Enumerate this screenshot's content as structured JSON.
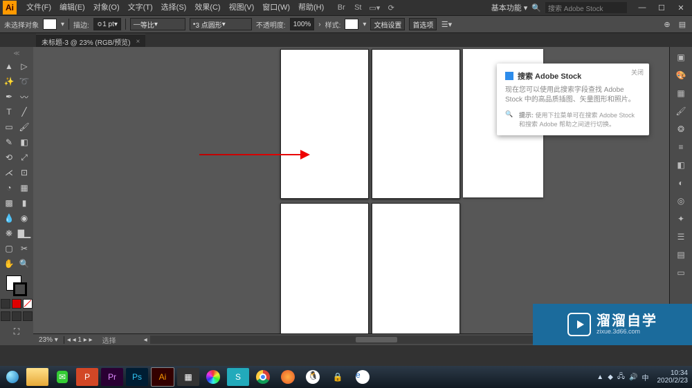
{
  "menu": {
    "file": "文件(F)",
    "edit": "编辑(E)",
    "object": "对象(O)",
    "type": "文字(T)",
    "select": "选择(S)",
    "effect": "效果(C)",
    "view": "视图(V)",
    "window": "窗口(W)",
    "help": "帮助(H)"
  },
  "workspace_switch": "基本功能",
  "search_placeholder": "搜索 Adobe Stock",
  "control": {
    "no_selection": "未选择对象",
    "stroke_label": "描边:",
    "stroke_val": "1 pt",
    "uniform": "等比",
    "dash": "3 点圆形",
    "opacity_label": "不透明度:",
    "opacity_val": "100%",
    "style_label": "样式:",
    "doc_setup": "文档设置",
    "prefs": "首选项"
  },
  "tab": {
    "title": "未标题-3 @ 23% (RGB/预览)"
  },
  "popup": {
    "title": "搜索 Adobe Stock",
    "close": "关闭",
    "body": "现在您可以使用此搜索字段查找 Adobe Stock 中的高品质插图、矢量图形和照片。",
    "hint_label": "提示:",
    "hint_body": "使用下拉菜单可在搜索 Adobe Stock 和搜索 Adobe 帮助之间进行切换。"
  },
  "status": {
    "zoom": "23%",
    "mode": "选择"
  },
  "watermark": {
    "brand": "溜溜自学",
    "url": "zixue.3d66.com"
  },
  "clock": {
    "time": "10:34",
    "date": "2020/2/23"
  }
}
